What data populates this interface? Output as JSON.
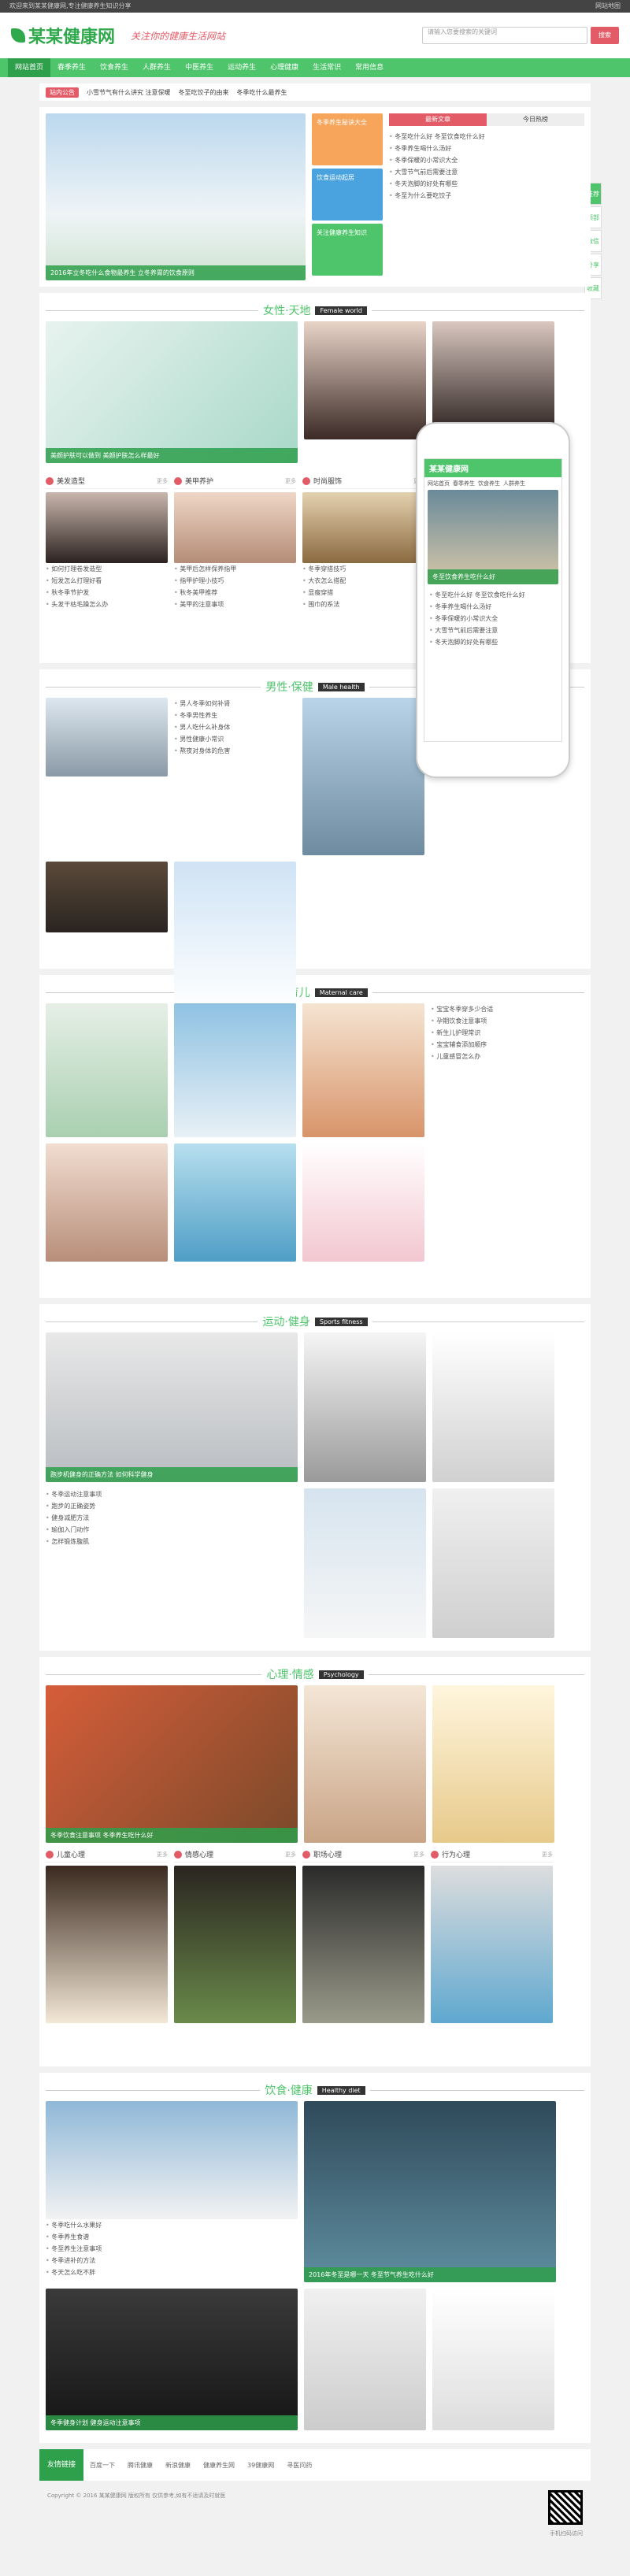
{
  "topbar": {
    "left": "欢迎来到某某健康网,专注健康养生知识分享",
    "right": "网站地图"
  },
  "header": {
    "logo": "某某健康网",
    "slogan": "关注你的健康生活网站",
    "search_placeholder": "请输入您要搜索的关键词",
    "search_button": "搜索"
  },
  "nav": [
    "网站首页",
    "春季养生",
    "饮食养生",
    "人群养生",
    "中医养生",
    "运动养生",
    "心理健康",
    "生活常识",
    "常用信息"
  ],
  "notice": {
    "badge": "站内公告",
    "items": [
      "小雪节气有什么讲究 注意保暖",
      "冬至吃饺子的由来",
      "冬季吃什么最养生"
    ]
  },
  "hero": {
    "caption": "2016年立冬吃什么食物最养生 立冬养胃的饮食原则",
    "side_lines": [
      "冬季养生秘诀大全",
      "饮食运动起居",
      "关注健康养生知识"
    ]
  },
  "hot": {
    "tabs": [
      "最新文章",
      "今日热榜"
    ],
    "items": [
      "冬至吃什么好 冬至饮食吃什么好",
      "冬季养生喝什么汤好",
      "冬季保暖的小常识大全",
      "大雪节气前后需要注意",
      "冬天泡脚的好处有哪些",
      "冬至为什么要吃饺子"
    ]
  },
  "female": {
    "title": "女性·天地",
    "en": "Female world",
    "caption": "美颜护肤可以做到 美颜护肤怎么样最好",
    "blocks": [
      {
        "label": "美发造型",
        "items": [
          "如何打理卷发造型",
          "短发怎么打理好看",
          "秋冬季节护发",
          "头发干枯毛躁怎么办"
        ]
      },
      {
        "label": "美甲养护",
        "items": [
          "美甲后怎样保养指甲",
          "指甲护理小技巧",
          "秋冬美甲推荐",
          "美甲的注意事项"
        ]
      },
      {
        "label": "时尚服饰",
        "items": [
          "冬季穿搭技巧",
          "大衣怎么搭配",
          "显瘦穿搭",
          "围巾的系法"
        ]
      }
    ]
  },
  "male": {
    "title": "男性·保健",
    "en": "Male health",
    "items": [
      "男人冬季如何补肾",
      "冬季男性养生",
      "男人吃什么补身体",
      "男性健康小常识",
      "熬夜对身体的危害"
    ]
  },
  "maternal": {
    "title": "母婴·育儿",
    "en": "Maternal care",
    "items": [
      "宝宝冬季穿多少合适",
      "孕期饮食注意事项",
      "新生儿护理常识",
      "宝宝辅食添加顺序",
      "儿童感冒怎么办"
    ]
  },
  "sports": {
    "title": "运动·健身",
    "en": "Sports fitness",
    "caption": "跑步机健身的正确方法 如何科学健身",
    "items": [
      "冬季运动注意事项",
      "跑步的正确姿势",
      "健身减肥方法",
      "瑜伽入门动作",
      "怎样锻炼腹肌"
    ]
  },
  "psychology": {
    "title": "心理·情感",
    "en": "Psychology",
    "caption": "冬季饮食注意事项 冬季养生吃什么好",
    "blocks": [
      "儿童心理",
      "情感心理",
      "职场心理",
      "行为心理"
    ]
  },
  "diet": {
    "title": "饮食·健康",
    "en": "Healthy diet",
    "caption": "2016年冬至是哪一天 冬至节气养生吃什么好",
    "caption2": "冬季健身计划 健身运动注意事项",
    "items": [
      "冬季吃什么水果好",
      "冬季养生食谱",
      "冬至养生注意事项",
      "冬季进补的方法",
      "冬天怎么吃不胖"
    ]
  },
  "side": [
    "推荐",
    "顶部",
    "微信",
    "分享",
    "收藏"
  ],
  "phone": {
    "title": "某某健康网",
    "nav": [
      "网站首页",
      "春季养生",
      "饮食养生",
      "人群养生"
    ],
    "caption": "冬至饮食养生吃什么好"
  },
  "footer": {
    "label": "友情链接",
    "links": [
      "百度一下",
      "腾讯健康",
      "新浪健康",
      "健康养生网",
      "39健康网",
      "寻医问药"
    ],
    "copyright": "Copyright © 2016 某某健康网 版权所有 仅供参考,如有不适请及时就医",
    "qr_label": "手机扫码访问"
  }
}
